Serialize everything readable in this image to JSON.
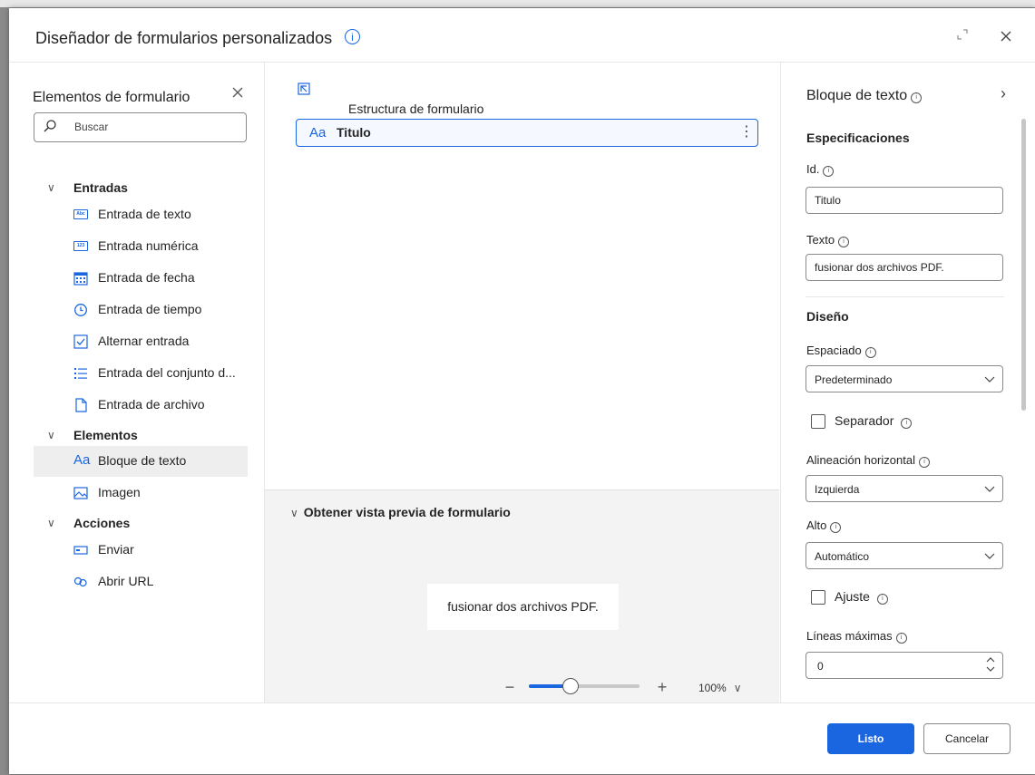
{
  "dialog": {
    "title": "Diseñador de formularios personalizados",
    "info_glyph": "i"
  },
  "left_panel": {
    "title": "Elementos de formulario",
    "search_placeholder": "Buscar",
    "groups": [
      {
        "label": "Entradas",
        "items": [
          {
            "label": "Entrada de texto",
            "icon": "text-input-icon"
          },
          {
            "label": "Entrada numérica",
            "icon": "number-input-icon"
          },
          {
            "label": "Entrada de fecha",
            "icon": "calendar-icon"
          },
          {
            "label": "Entrada de tiempo",
            "icon": "clock-icon"
          },
          {
            "label": "Alternar entrada",
            "icon": "checkbox-icon"
          },
          {
            "label": "Entrada del conjunto d...",
            "icon": "list-icon"
          },
          {
            "label": "Entrada de archivo",
            "icon": "file-icon"
          }
        ]
      },
      {
        "label": "Elementos",
        "items": [
          {
            "label": "Bloque de texto",
            "icon": "text-block-icon",
            "glyph": "Aa",
            "selected": true
          },
          {
            "label": "Imagen",
            "icon": "image-icon"
          }
        ]
      },
      {
        "label": "Acciones",
        "items": [
          {
            "label": "Enviar",
            "icon": "submit-icon"
          },
          {
            "label": "Abrir URL",
            "icon": "link-icon"
          }
        ]
      }
    ]
  },
  "center": {
    "structure_title": "Estructura de formulario",
    "rows": [
      {
        "glyph": "Aa",
        "label": "Titulo"
      }
    ],
    "preview_title": "Obtener vista previa de formulario",
    "preview_text": "fusionar dos archivos PDF.",
    "zoom_label": "100%",
    "zoom_level": 0.38
  },
  "right_panel": {
    "title": "Bloque de texto",
    "spec_section": "Especificaciones",
    "id_label": "Id.",
    "id_value": "Titulo",
    "text_label": "Texto",
    "text_value": "fusionar dos archivos PDF.",
    "design_section": "Diseño",
    "spacing_label": "Espaciado",
    "spacing_value": "Predeterminado",
    "separator_label": "Separador",
    "separator_checked": false,
    "halign_label": "Alineación horizontal",
    "halign_value": "Izquierda",
    "height_label": "Alto",
    "height_value": "Automático",
    "wrap_label": "Ajuste",
    "wrap_checked": false,
    "maxlines_label": "Líneas máximas",
    "maxlines_value": "0"
  },
  "footer": {
    "ok_label": "Listo",
    "cancel_label": "Cancelar"
  },
  "colors": {
    "accent": "#1a66e0",
    "selected_bg": "#eeeeee",
    "preview_bg": "#f3f3f3"
  }
}
